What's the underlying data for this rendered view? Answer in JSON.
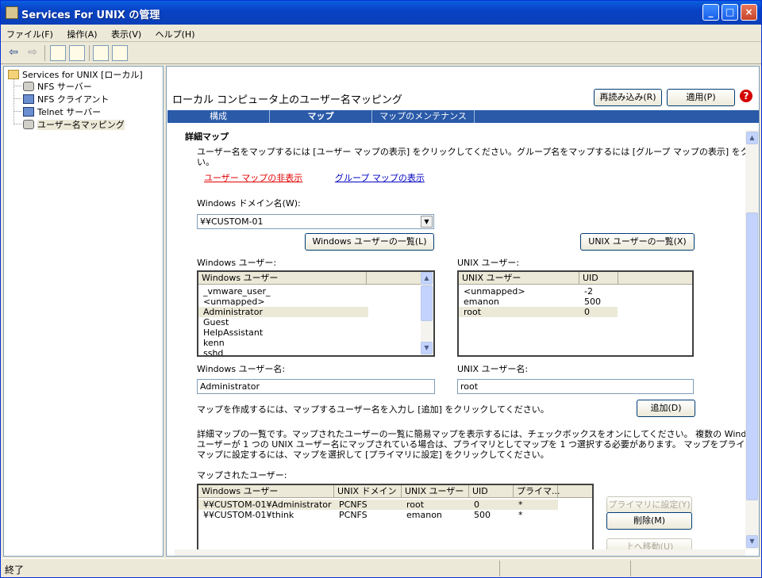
{
  "window": {
    "title": "Services For UNIX の管理"
  },
  "title_buttons": {
    "minimize": "_",
    "maximize": "□",
    "close": "×"
  },
  "menu": {
    "items": [
      "ファイル(F)",
      "操作(A)",
      "表示(V)",
      "ヘルプ(H)"
    ]
  },
  "toolbar": {
    "back": "⇦",
    "forward": "⇨"
  },
  "tree": {
    "root": "Services for UNIX [ローカル]",
    "items": [
      "NFS サーバー",
      "NFS クライアント",
      "Telnet サーバー",
      "ユーザー名マッピング"
    ]
  },
  "header": {
    "title": "ローカル コンピュータ上のユーザー名マッピング",
    "reload_label": "再読み込み(R)",
    "apply_label": "適用(P)",
    "help_symbol": "?"
  },
  "tabs": [
    "構成",
    "マップ",
    "マップのメンテナンス"
  ],
  "map_section": {
    "heading": "詳細マップ",
    "description": "ユーザー名をマップするには [ユーザー マップの表示] をクリックしてください。グループ名をマップするには [グループ マップの表示] をクリックしてくださ",
    "description_wrap": "い。",
    "hide_user_map_link": "ユーザー マップの非表示",
    "show_group_map_link": "グループ マップの表示",
    "domain_label": "Windows ドメイン名(W):",
    "domain_value": "¥¥CUSTOM-01",
    "list_windows_users_button": "Windows ユーザーの一覧(L)",
    "list_unix_users_button": "UNIX ユーザーの一覧(X)",
    "windows_users_label": "Windows ユーザー:",
    "unix_users_label": "UNIX ユーザー:",
    "windows_users_header": "Windows ユーザー",
    "windows_users": [
      "_vmware_user_",
      "<unmapped>",
      "Administrator",
      "Guest",
      "HelpAssistant",
      "kenn",
      "sshd"
    ],
    "unix_users_headers": {
      "name": "UNIX ユーザー",
      "uid": "UID"
    },
    "unix_users": [
      {
        "name": "<unmapped>",
        "uid": "-2"
      },
      {
        "name": "emanon",
        "uid": "500"
      },
      {
        "name": "root",
        "uid": "0"
      }
    ],
    "windows_user_name_label": "Windows ユーザー名:",
    "windows_user_name_value": "Administrator",
    "unix_user_name_label": "UNIX ユーザー名:",
    "unix_user_name_value": "root",
    "create_instruction": "マップを作成するには、マップするユーザー名を入力し [追加] をクリックしてください。",
    "add_button": "追加(D)",
    "mapped_description_1": "詳細マップの一覧です。マップされたユーザーの一覧に簡易マップを表示するには、チェックボックスをオンにしてください。 複数の Windows",
    "mapped_description_2": "ユーザーが 1 つの UNIX ユーザー名にマップされている場合は、プライマリとしてマップを 1 つ選択する必要があります。 マップをプライマリ",
    "mapped_description_3": "マップに設定するには、マップを選択して [プライマリに設定] をクリックしてください。",
    "mapped_users_label": "マップされたユーザー:",
    "mapped_headers": {
      "windows_user": "Windows ユーザー",
      "unix_domain": "UNIX ドメイン",
      "unix_user": "UNIX ユーザー",
      "uid": "UID",
      "primary": "プライマ..."
    },
    "mapped_rows": [
      {
        "windows_user": "¥¥CUSTOM-01¥Administrator",
        "unix_domain": "PCNFS",
        "unix_user": "root",
        "uid": "0",
        "primary": "*"
      },
      {
        "windows_user": "¥¥CUSTOM-01¥think",
        "unix_domain": "PCNFS",
        "unix_user": "emanon",
        "uid": "500",
        "primary": "*"
      }
    ],
    "set_primary_button": "プライマリに設定(Y)",
    "delete_button": "削除(M)",
    "move_up_button": "上へ移動(U)"
  },
  "status": {
    "text": "終了"
  }
}
